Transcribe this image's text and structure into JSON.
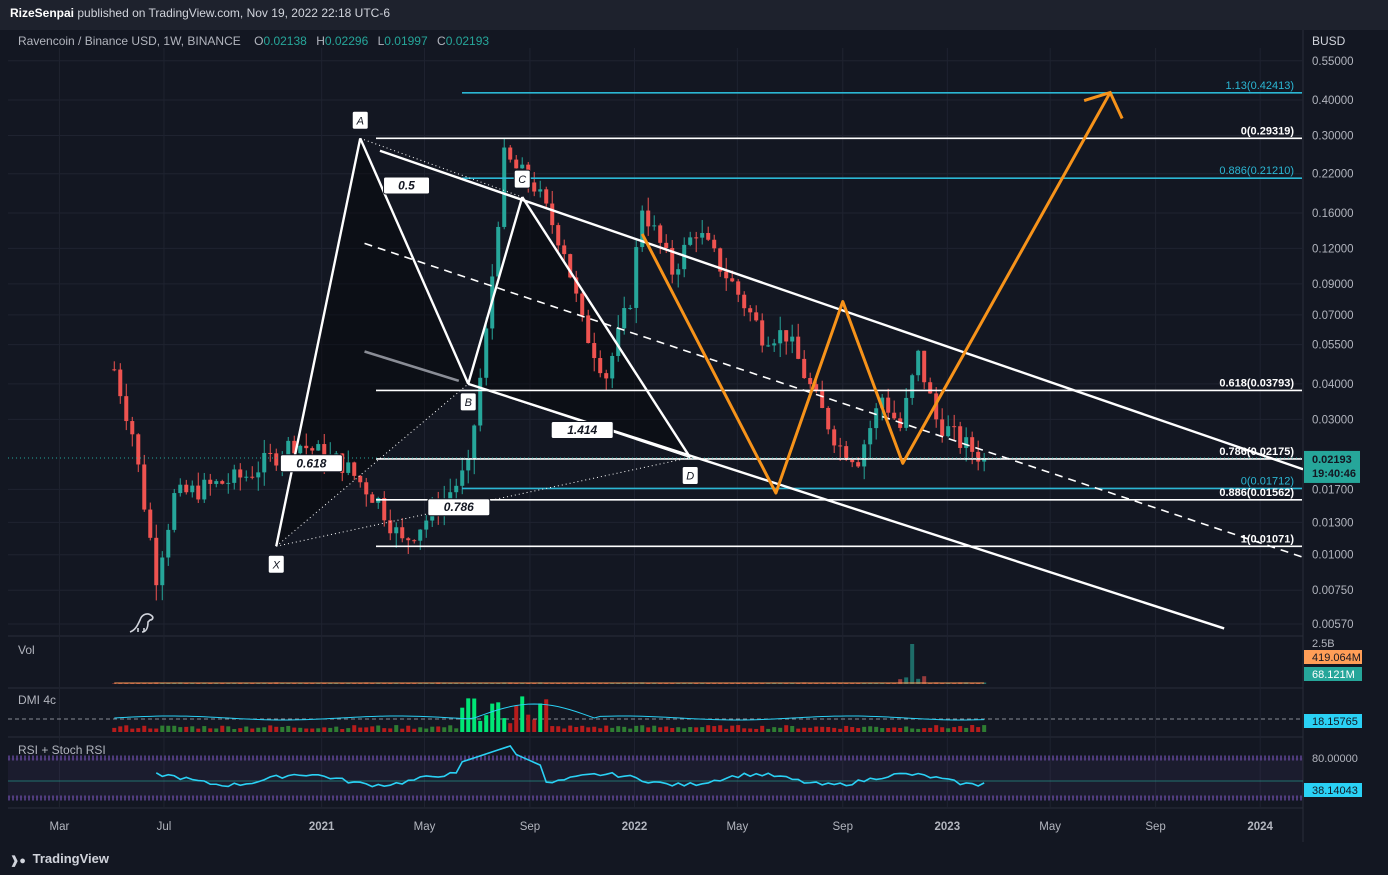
{
  "header": {
    "publisher": "RizeSenpai",
    "published_text": "published on TradingView.com, Nov 19, 2022 22:18 UTC-6"
  },
  "symbol": {
    "title": "Ravencoin / Binance USD, 1W, BINANCE",
    "ohlc": [
      {
        "key": "O",
        "value": "0.02138"
      },
      {
        "key": "H",
        "value": "0.02296"
      },
      {
        "key": "L",
        "value": "0.01997"
      },
      {
        "key": "C",
        "value": "0.02193"
      }
    ]
  },
  "colors": {
    "background": "#131722",
    "up": "#26a69a",
    "down": "#ef5350",
    "fib_white": "#ffffff",
    "fib_cyan": "#2bb7d4",
    "projection": "#f7931a",
    "rsi_line": "#2ad1f5",
    "rsi_band": "#7e57c2"
  },
  "footer": {
    "brand": "TradingView"
  },
  "chart_data": {
    "type": "candlestick",
    "scale": "log",
    "price_unit": "BUSD",
    "ylim": [
      0.0053,
      0.61
    ],
    "y_ticks": [
      "0.55000",
      "0.40000",
      "0.30000",
      "0.22000",
      "0.16000",
      "0.12000",
      "0.09000",
      "0.07000",
      "0.05500",
      "0.04000",
      "0.03000",
      "0.02193",
      "0.01700",
      "0.01300",
      "0.01000",
      "0.00750",
      "0.00570"
    ],
    "x_ticks": [
      "Mar",
      "Jul",
      "2021",
      "May",
      "Sep",
      "2022",
      "May",
      "Sep",
      "2023",
      "May",
      "Sep",
      "2024"
    ],
    "x_range": [
      "2020-01-01",
      "2024-02-20"
    ],
    "last_price": {
      "value": 0.02193,
      "label": "0.02193",
      "countdown": "19:40:46"
    },
    "anchors": [
      {
        "week": 0,
        "price": 0.045
      },
      {
        "week": 3,
        "price": 0.027
      },
      {
        "week": 7,
        "price": 0.0085
      },
      {
        "week": 10,
        "price": 0.016
      },
      {
        "week": 22,
        "price": 0.019
      },
      {
        "week": 30,
        "price": 0.025
      },
      {
        "week": 38,
        "price": 0.021
      },
      {
        "week": 44,
        "price": 0.0155
      },
      {
        "week": 48,
        "price": 0.011
      },
      {
        "week": 53,
        "price": 0.014
      },
      {
        "week": 59,
        "price": 0.02
      },
      {
        "week": 62,
        "price": 0.06
      },
      {
        "week": 65,
        "price": 0.25
      },
      {
        "week": 70,
        "price": 0.2
      },
      {
        "week": 75,
        "price": 0.12
      },
      {
        "week": 78,
        "price": 0.065
      },
      {
        "week": 82,
        "price": 0.043
      },
      {
        "week": 86,
        "price": 0.08
      },
      {
        "week": 88,
        "price": 0.17
      },
      {
        "week": 93,
        "price": 0.1
      },
      {
        "week": 97,
        "price": 0.14
      },
      {
        "week": 103,
        "price": 0.09
      },
      {
        "week": 108,
        "price": 0.06
      },
      {
        "week": 112,
        "price": 0.06
      },
      {
        "week": 117,
        "price": 0.035
      },
      {
        "week": 121,
        "price": 0.024
      },
      {
        "week": 124,
        "price": 0.022
      },
      {
        "week": 128,
        "price": 0.036
      },
      {
        "week": 131,
        "price": 0.028
      },
      {
        "week": 134,
        "price": 0.05
      },
      {
        "week": 137,
        "price": 0.03
      },
      {
        "week": 141,
        "price": 0.025
      },
      {
        "week": 145,
        "price": 0.0219
      }
    ],
    "fib_levels": [
      {
        "label": "1.13(0.42413)",
        "price": 0.42413,
        "color": "cyan"
      },
      {
        "label": "0(0.29319)",
        "price": 0.29319,
        "color": "white"
      },
      {
        "label": "0.886(0.21210)",
        "price": 0.2121,
        "color": "cyan"
      },
      {
        "label": "0.618(0.03793)",
        "price": 0.03793,
        "color": "white"
      },
      {
        "label": "0.786(0.02175)",
        "price": 0.02175,
        "color": "white"
      },
      {
        "label": "0(0.01712)",
        "price": 0.01712,
        "color": "cyan"
      },
      {
        "label": "0.886(0.01562)",
        "price": 0.01562,
        "color": "white"
      },
      {
        "label": "1(0.01071)",
        "price": 0.01071,
        "color": "white"
      }
    ],
    "harmonic_points": [
      {
        "label": "X",
        "date": "2020-11-09",
        "price": 0.01071
      },
      {
        "label": "A",
        "date": "2021-02-15",
        "price": 0.29319
      },
      {
        "label": "B",
        "date": "2021-06-21",
        "price": 0.04
      },
      {
        "label": "C",
        "date": "2021-08-23",
        "price": 0.182
      },
      {
        "label": "D",
        "date": "2022-03-07",
        "price": 0.022
      }
    ],
    "ratios": [
      {
        "label": "0.5",
        "date": "2021-04-10",
        "price": 0.2
      },
      {
        "label": "0.618",
        "date": "2020-12-20",
        "price": 0.021
      },
      {
        "label": "1.414",
        "date": "2021-11-01",
        "price": 0.0275
      },
      {
        "label": "0.786",
        "date": "2021-06-10",
        "price": 0.0147
      }
    ],
    "projection": [
      {
        "date": "2022-01-10",
        "price": 0.135
      },
      {
        "date": "2022-06-15",
        "price": 0.0165
      },
      {
        "date": "2022-09-01",
        "price": 0.078
      },
      {
        "date": "2022-11-10",
        "price": 0.021
      },
      {
        "date": "2023-07-10",
        "price": 0.425
      }
    ],
    "panes": [
      {
        "name": "Vol",
        "labels": [
          "2.5B",
          "419.064M",
          "68.121M"
        ]
      },
      {
        "name": "DMI 4c",
        "labels": [
          "18.15765"
        ]
      },
      {
        "name": "RSI + Stoch RSI",
        "labels": [
          "80.00000",
          "38.14043"
        ]
      }
    ]
  }
}
